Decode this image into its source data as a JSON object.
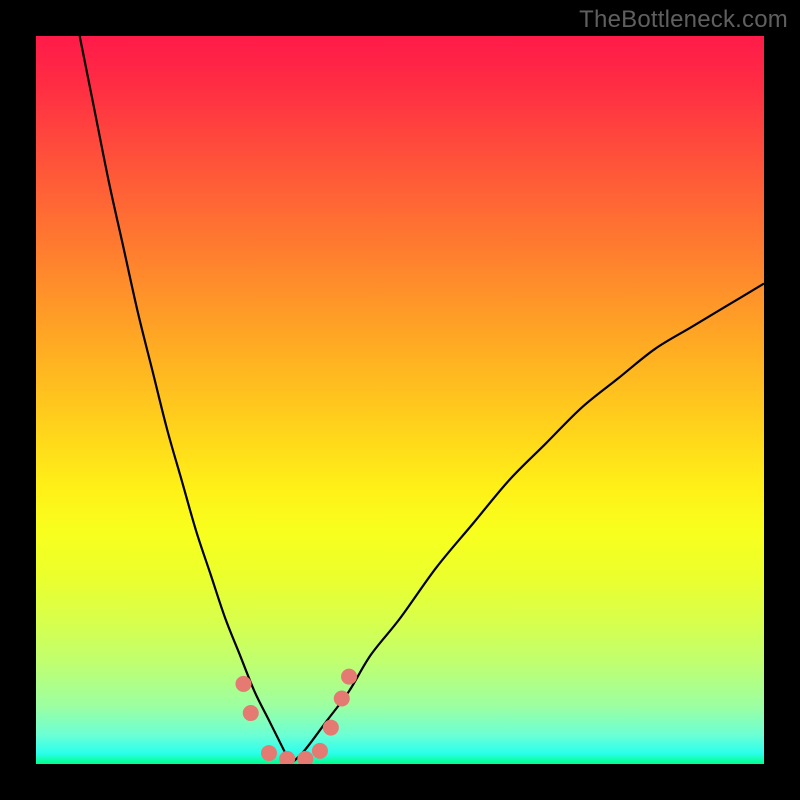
{
  "watermark": "TheBottleneck.com",
  "chart_data": {
    "type": "line",
    "title": "",
    "xlabel": "",
    "ylabel": "",
    "xlim": [
      0,
      100
    ],
    "ylim": [
      0,
      100
    ],
    "grid": false,
    "legend": false,
    "background_gradient_stops": [
      {
        "pos": 0.0,
        "color": "#ff1b49"
      },
      {
        "pos": 0.06,
        "color": "#ff2a44"
      },
      {
        "pos": 0.14,
        "color": "#ff473d"
      },
      {
        "pos": 0.24,
        "color": "#ff6a34"
      },
      {
        "pos": 0.34,
        "color": "#ff8d2b"
      },
      {
        "pos": 0.44,
        "color": "#ffb022"
      },
      {
        "pos": 0.54,
        "color": "#ffd31b"
      },
      {
        "pos": 0.62,
        "color": "#fff018"
      },
      {
        "pos": 0.68,
        "color": "#f8ff1d"
      },
      {
        "pos": 0.74,
        "color": "#ecff2c"
      },
      {
        "pos": 0.8,
        "color": "#d9ff4a"
      },
      {
        "pos": 0.86,
        "color": "#c0ff6f"
      },
      {
        "pos": 0.92,
        "color": "#9cffa1"
      },
      {
        "pos": 0.96,
        "color": "#6cffd4"
      },
      {
        "pos": 0.985,
        "color": "#2bffec"
      },
      {
        "pos": 1.0,
        "color": "#00ff88"
      }
    ],
    "series": [
      {
        "name": "left-branch",
        "x": [
          6,
          8,
          10,
          12,
          14,
          16,
          18,
          20,
          22,
          24,
          26,
          28,
          30,
          32,
          34,
          35
        ],
        "y": [
          100,
          90,
          80,
          71,
          62,
          54,
          46,
          39,
          32,
          26,
          20,
          15,
          10,
          6,
          2,
          0
        ]
      },
      {
        "name": "right-branch",
        "x": [
          35,
          37,
          40,
          43,
          46,
          50,
          55,
          60,
          65,
          70,
          75,
          80,
          85,
          90,
          95,
          100
        ],
        "y": [
          0,
          2,
          6,
          10,
          15,
          20,
          27,
          33,
          39,
          44,
          49,
          53,
          57,
          60,
          63,
          66
        ]
      }
    ],
    "markers": {
      "color": "#e47a72",
      "radius_pct": 1.1,
      "points": [
        {
          "x": 28.5,
          "y": 11
        },
        {
          "x": 29.5,
          "y": 7
        },
        {
          "x": 32.0,
          "y": 1.5
        },
        {
          "x": 34.5,
          "y": 0.7
        },
        {
          "x": 37.0,
          "y": 0.7
        },
        {
          "x": 39.0,
          "y": 1.8
        },
        {
          "x": 40.5,
          "y": 5
        },
        {
          "x": 42.0,
          "y": 9
        },
        {
          "x": 43.0,
          "y": 12
        }
      ]
    }
  }
}
